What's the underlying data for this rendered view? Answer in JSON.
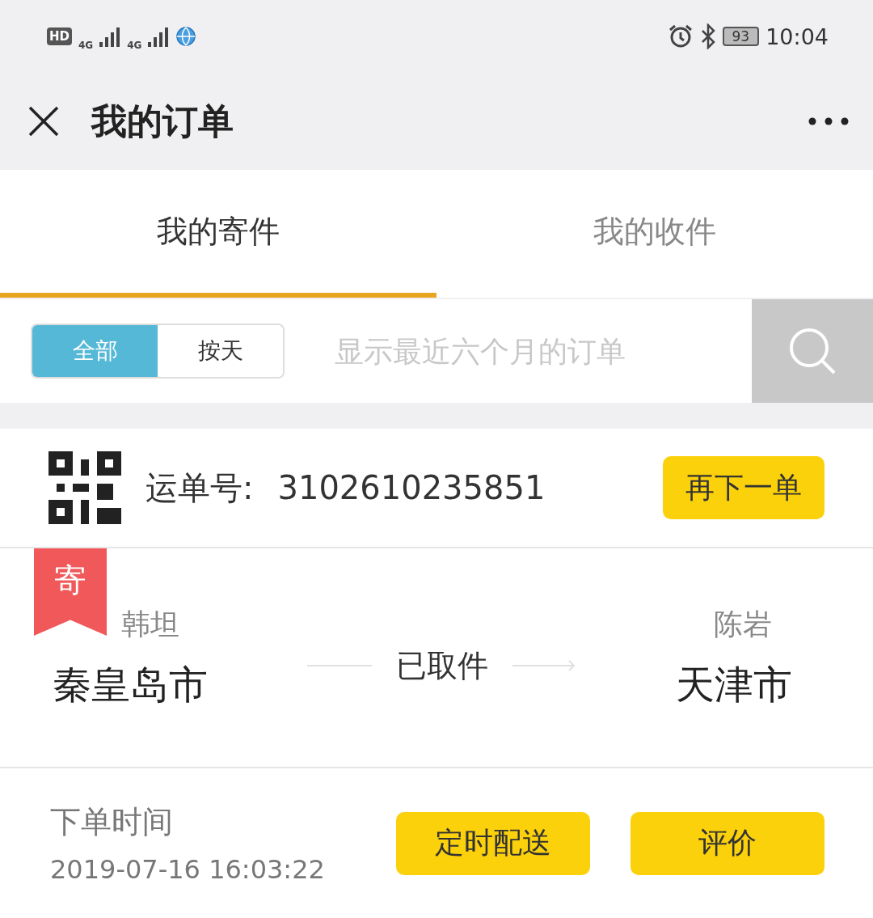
{
  "status_bar": {
    "hd": "HD",
    "network_1": "4G",
    "network_2": "4G",
    "battery": "93",
    "time": "10:04"
  },
  "header": {
    "title": "我的订单"
  },
  "tabs": [
    {
      "label": "我的寄件",
      "selected": true
    },
    {
      "label": "我的收件",
      "selected": false
    }
  ],
  "filter": {
    "segments": [
      {
        "label": "全部",
        "selected": true
      },
      {
        "label": "按天",
        "selected": false
      }
    ],
    "placeholder": "显示最近六个月的订单"
  },
  "order": {
    "waybill_label": "运单号:",
    "waybill_number": "3102610235851",
    "reorder_button": "再下一单",
    "tag": "寄",
    "sender": {
      "name": "韩坦",
      "city": "秦皇岛市"
    },
    "status": "已取件",
    "receiver": {
      "name": "陈岩",
      "city": "天津市"
    },
    "order_time_label": "下单时间",
    "order_time": "2019-07-16 16:03:22",
    "buttons": [
      "定时配送",
      "评价"
    ]
  }
}
